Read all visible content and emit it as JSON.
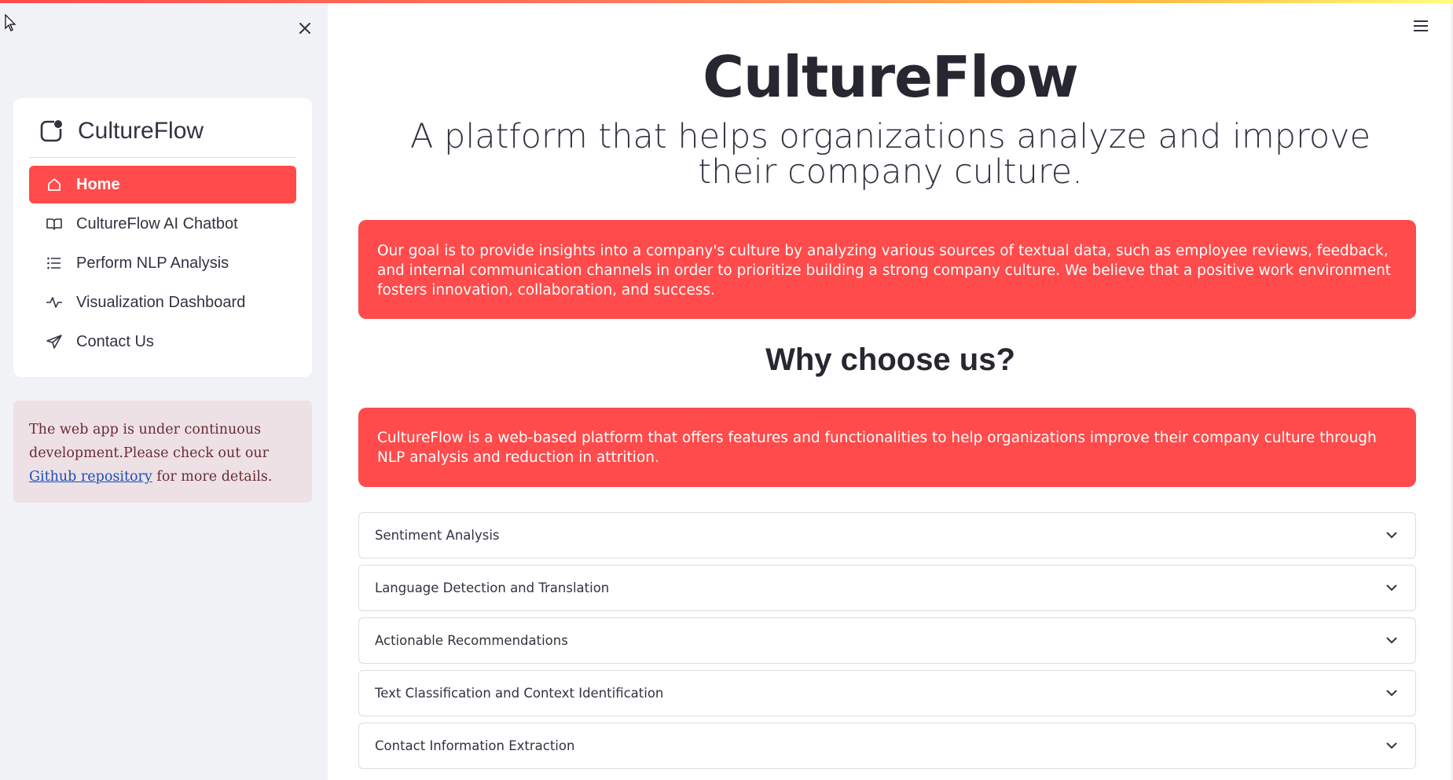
{
  "sidebar": {
    "menu_title": "CultureFlow",
    "items": [
      {
        "label": "Home",
        "icon": "house-icon",
        "active": true
      },
      {
        "label": "CultureFlow AI Chatbot",
        "icon": "book-icon",
        "active": false
      },
      {
        "label": "Perform NLP Analysis",
        "icon": "list-icon",
        "active": false
      },
      {
        "label": "Visualization Dashboard",
        "icon": "activity-icon",
        "active": false
      },
      {
        "label": "Contact Us",
        "icon": "send-icon",
        "active": false
      }
    ],
    "notice": {
      "text_before": "The web app is under continuous development.Please check out our ",
      "link_text": "Github repository",
      "text_after": " for more details."
    }
  },
  "main": {
    "title": "CultureFlow",
    "subtitle": "A platform that helps organizations analyze and improve their company culture.",
    "goal_text": "Our goal is to provide insights into a company's culture by analyzing various sources of textual data, such as employee reviews, feedback, and internal communication channels in order to prioritize building a strong company culture. We believe that a positive work environment fosters innovation, collaboration, and success.",
    "why_title": "Why choose us?",
    "why_text": "CultureFlow is a web-based platform that offers features and functionalities to help organizations improve their company culture through NLP analysis and reduction in attrition.",
    "features": [
      {
        "label": "Sentiment Analysis"
      },
      {
        "label": "Language Detection and Translation"
      },
      {
        "label": "Actionable Recommendations"
      },
      {
        "label": "Text Classification and Context Identification"
      },
      {
        "label": "Contact Information Extraction"
      }
    ]
  },
  "colors": {
    "accent": "#ff4b4b",
    "sidebar_bg": "#f0f2f6",
    "notice_bg": "#ede1e5",
    "text": "#31333f"
  }
}
